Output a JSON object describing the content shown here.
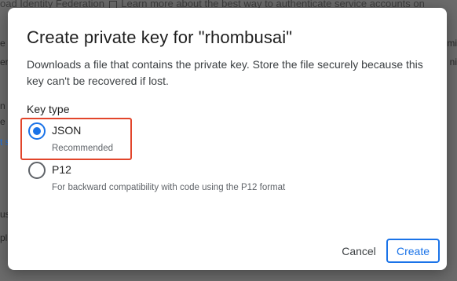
{
  "background": {
    "top_text": "oad Identity Federation",
    "top_text_2": "Learn more about the best way to authenticate service accounts on",
    "left_fragments": [
      "e s",
      "er",
      "n",
      "t s",
      "e",
      "us",
      "pl"
    ],
    "right_fragments": [
      "mi",
      "ni"
    ]
  },
  "dialog": {
    "title": "Create private key for \"rhombusai\"",
    "description": "Downloads a file that contains the private key. Store the file securely because this key can't be recovered if lost.",
    "key_type_label": "Key type",
    "options": [
      {
        "label": "JSON",
        "sublabel": "Recommended",
        "checked": true
      },
      {
        "label": "P12",
        "sublabel": "For backward compatibility with code using the P12 format",
        "checked": false
      }
    ],
    "cancel_label": "Cancel",
    "create_label": "Create"
  },
  "colors": {
    "accent": "#1a73e8",
    "highlight": "#e2452b"
  }
}
